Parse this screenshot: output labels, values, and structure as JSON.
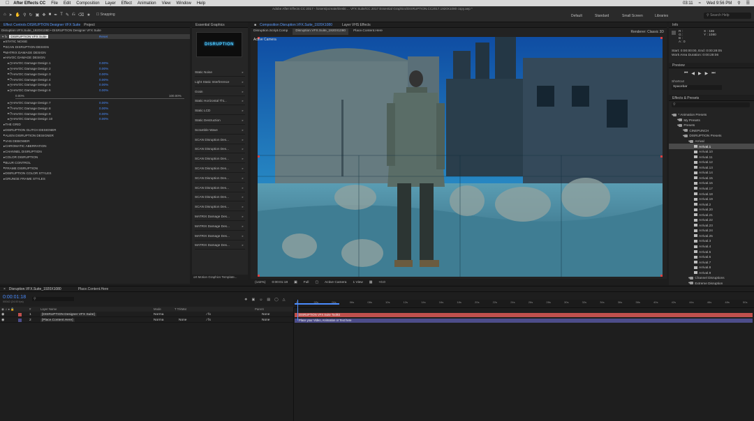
{
  "menubar": {
    "apple": "",
    "app": "After Effects CC",
    "items": [
      "File",
      "Edit",
      "Composition",
      "Layer",
      "Effect",
      "Animation",
      "View",
      "Window",
      "Help"
    ],
    "battery": "03:11",
    "clock": "Wed 9:56 PM"
  },
  "toolbar": {
    "title": "Adobe After Effects CC 2017 - /Users/pcreate/Deskt ... VFX Suite/CC 2017 Essential Graphics/DISRUPTION.CC2017.1920X1080 copy.aep *",
    "snapping": "Snapping",
    "workspaces": [
      "Default",
      "Standard",
      "Small Screen",
      "Libraries"
    ],
    "search_placeholder": "Search Help"
  },
  "effect_controls": {
    "tabs": [
      "Effect Controls DISRUPTION Designer VFX Suite",
      "Project"
    ],
    "subtitle": "Disruption.VFX.Suite_1920X1080 • DISRUPTION Designer VFX Suite",
    "effect_name": "DISRUPTION VFX Suite",
    "reset": "Reset",
    "rows": [
      {
        "label": "STATIC NOISE",
        "indent": 1,
        "value": ""
      },
      {
        "label": "SCAN DISRUPTION DESIGN",
        "indent": 1,
        "value": ""
      },
      {
        "label": "MATRIX DAMAGE DESIGN",
        "indent": 1,
        "value": ""
      },
      {
        "label": "HAVOC DAMAGE DESIGN",
        "indent": 1,
        "value": ""
      },
      {
        "label": "HAVOC Damage Design 1",
        "indent": 3,
        "value": "0.00%"
      },
      {
        "label": "HAVOC Damage Design 2",
        "indent": 3,
        "value": "0.00%"
      },
      {
        "label": "HAVOC Damage Design 3",
        "indent": 3,
        "value": "0.00%"
      },
      {
        "label": "HAVOC Damage Design 4",
        "indent": 3,
        "value": "0.00%"
      },
      {
        "label": "HAVOC Damage Design 5",
        "indent": 3,
        "value": "0.00%"
      },
      {
        "label": "HAVOC Damage Design 6",
        "indent": 3,
        "value": "0.00%"
      },
      {
        "label": "HAVOC Damage Design 7",
        "indent": 3,
        "value": "0.00%"
      },
      {
        "label": "HAVOC Damage Design 8",
        "indent": 3,
        "value": "0.00%"
      },
      {
        "label": "HAVOC Damage Design 9",
        "indent": 3,
        "value": "0.00%"
      },
      {
        "label": "HAVOC Damage Design 10",
        "indent": 3,
        "value": "0.00%"
      },
      {
        "label": "THE GRID",
        "indent": 1,
        "value": ""
      },
      {
        "label": "DISRUPTION GLITCH DESIGNER",
        "indent": 1,
        "value": ""
      },
      {
        "label": "ALIEN DISRUPTION DESIGNER",
        "indent": 1,
        "value": ""
      },
      {
        "label": "VHS DEBOWER",
        "indent": 1,
        "value": ""
      },
      {
        "label": "CHROMATIC ABERRATION",
        "indent": 1,
        "value": ""
      },
      {
        "label": "CHANNEL DISRUPTION",
        "indent": 1,
        "value": ""
      },
      {
        "label": "COLOR DISRUPTION",
        "indent": 1,
        "value": ""
      },
      {
        "label": "BLUR CONTROL",
        "indent": 1,
        "value": ""
      },
      {
        "label": "FRAME DISRUPTION",
        "indent": 1,
        "value": ""
      },
      {
        "label": "DISRUPTION COLOR STYLES",
        "indent": 1,
        "value": ""
      },
      {
        "label": "GRUNGE FRAME STYLES",
        "indent": 1,
        "value": ""
      }
    ],
    "slider_min": "0.00%",
    "slider_max": "100.00%"
  },
  "essential_graphics": {
    "tab": "Essential Graphics",
    "thumb_text": "DISRUPTION",
    "items": [
      "Static Noise",
      "Light Static Interference",
      "Grain",
      "Static Horizontal Thi...",
      "Static LCD",
      "Static Destruction",
      "Scramble Wave",
      "SCAN Disruption Des...",
      "SCAN Disruption Des...",
      "SCAN Disruption Des...",
      "SCAN Disruption Des...",
      "SCAN Disruption Des...",
      "SCAN Disruption Des...",
      "SCAN Disruption Des...",
      "SCAN Disruption Des...",
      "MATRIX Damage Des...",
      "MATRIX Damage Des...",
      "MATRIX Damage Des...",
      "MATRIX Damage Des..."
    ],
    "footer": "ort Motion Graphics Template..."
  },
  "composition": {
    "tabs": [
      "Composition Disruption.VFX.Suite_1920X1080",
      "Layer VHS Effects"
    ],
    "subtabs": [
      "Disruption.Script.Comp",
      "Disruption.VFX.Suite_1920X1080",
      "Place.Content.Here"
    ],
    "renderer": "Renderer:",
    "renderer_value": "Classic 3D",
    "active_camera": "Active Camera",
    "viewer_bar": [
      "(142%)",
      "0:00:01:18",
      "Full",
      "Active Camera",
      "1 View",
      "+0.0"
    ]
  },
  "info": {
    "tab": "Info",
    "r": "R :",
    "g": "G :",
    "b": "B :",
    "a": "A : 0",
    "x": "X : 186",
    "y": "Y : 1080",
    "start": "Start: 0:00:00:00, End: 0:00:28:05",
    "duration": "Work Area Duration: 0:00:28:06"
  },
  "preview": {
    "tab": "Preview",
    "shortcut_label": "Shortcut",
    "shortcut_value": "Spacebar"
  },
  "effects_presets": {
    "tab": "Effects & Presets",
    "tree": [
      {
        "label": "* Animation Presets",
        "indent": 0,
        "type": "folder"
      },
      {
        "label": "My Presets",
        "indent": 1,
        "type": "folder"
      },
      {
        "label": "Presets",
        "indent": 1,
        "type": "folder"
      },
      {
        "label": "CINEPUNCH",
        "indent": 2,
        "type": "folder"
      },
      {
        "label": "DISRUPTION Presets",
        "indent": 2,
        "type": "folder"
      },
      {
        "label": "Arrival",
        "indent": 3,
        "type": "folder"
      },
      {
        "label": "Arrival.1",
        "indent": 4,
        "type": "file",
        "selected": true
      },
      {
        "label": "Arrival.10",
        "indent": 4,
        "type": "file"
      },
      {
        "label": "Arrival.11",
        "indent": 4,
        "type": "file"
      },
      {
        "label": "Arrival.12",
        "indent": 4,
        "type": "file"
      },
      {
        "label": "Arrival.13",
        "indent": 4,
        "type": "file"
      },
      {
        "label": "Arrival.14",
        "indent": 4,
        "type": "file"
      },
      {
        "label": "Arrival.15",
        "indent": 4,
        "type": "file"
      },
      {
        "label": "Arrival.16",
        "indent": 4,
        "type": "file"
      },
      {
        "label": "Arrival.17",
        "indent": 4,
        "type": "file"
      },
      {
        "label": "Arrival.18",
        "indent": 4,
        "type": "file"
      },
      {
        "label": "Arrival.19",
        "indent": 4,
        "type": "file"
      },
      {
        "label": "Arrival.2",
        "indent": 4,
        "type": "file"
      },
      {
        "label": "Arrival.20",
        "indent": 4,
        "type": "file"
      },
      {
        "label": "Arrival.21",
        "indent": 4,
        "type": "file"
      },
      {
        "label": "Arrival.22",
        "indent": 4,
        "type": "file"
      },
      {
        "label": "Arrival.23",
        "indent": 4,
        "type": "file"
      },
      {
        "label": "Arrival.24",
        "indent": 4,
        "type": "file"
      },
      {
        "label": "Arrival.25",
        "indent": 4,
        "type": "file"
      },
      {
        "label": "Arrival.3",
        "indent": 4,
        "type": "file"
      },
      {
        "label": "Arrival.4",
        "indent": 4,
        "type": "file"
      },
      {
        "label": "Arrival.5",
        "indent": 4,
        "type": "file"
      },
      {
        "label": "Arrival.6",
        "indent": 4,
        "type": "file"
      },
      {
        "label": "Arrival.7",
        "indent": 4,
        "type": "file"
      },
      {
        "label": "Arrival.8",
        "indent": 4,
        "type": "file"
      },
      {
        "label": "Arrival.9",
        "indent": 4,
        "type": "file"
      },
      {
        "label": "Channel Disruptions",
        "indent": 3,
        "type": "folder"
      },
      {
        "label": "Extreme Disruption",
        "indent": 3,
        "type": "folder"
      }
    ]
  },
  "timeline": {
    "tabs": [
      "Disruption.VFX.Suite_1920X1080",
      "Place.Content.Here"
    ],
    "timecode": "0:00:01:18",
    "timecode_sub": "00042 (24.00 fps)",
    "headers": {
      "num": "#",
      "name": "Layer Name",
      "mode": "Mode",
      "trkmat": "T TrkMat",
      "parent": "Parent"
    },
    "layers": [
      {
        "num": "1",
        "name": "[DISRUPTION Designer VFX Suite]",
        "mode": "Norma",
        "trk": "",
        "parent": "None",
        "bar": "DISRUPTION VFX Suite Toolkit",
        "color": "#c0504d"
      },
      {
        "num": "2",
        "name": "[Place.Content.Here]",
        "mode": "Norma",
        "trk": "None",
        "parent": "None",
        "bar": "Place your Video, Animation or Text here",
        "color": "#4d4d8a"
      }
    ],
    "ruler_ticks": [
      "0f",
      "02s",
      "04s",
      "06s",
      "08s",
      "10s",
      "12s",
      "14s",
      "16s",
      "18s",
      "20s",
      "22s",
      "24s",
      "26s",
      "28s",
      "30s",
      "32s",
      "34s",
      "36s",
      "38s",
      "40s",
      "42s",
      "44s",
      "46s",
      "48s",
      "50s"
    ]
  },
  "colors": {
    "accent": "#4a8cff",
    "layer1": "#c0504d",
    "layer2": "#4d4d8a"
  }
}
